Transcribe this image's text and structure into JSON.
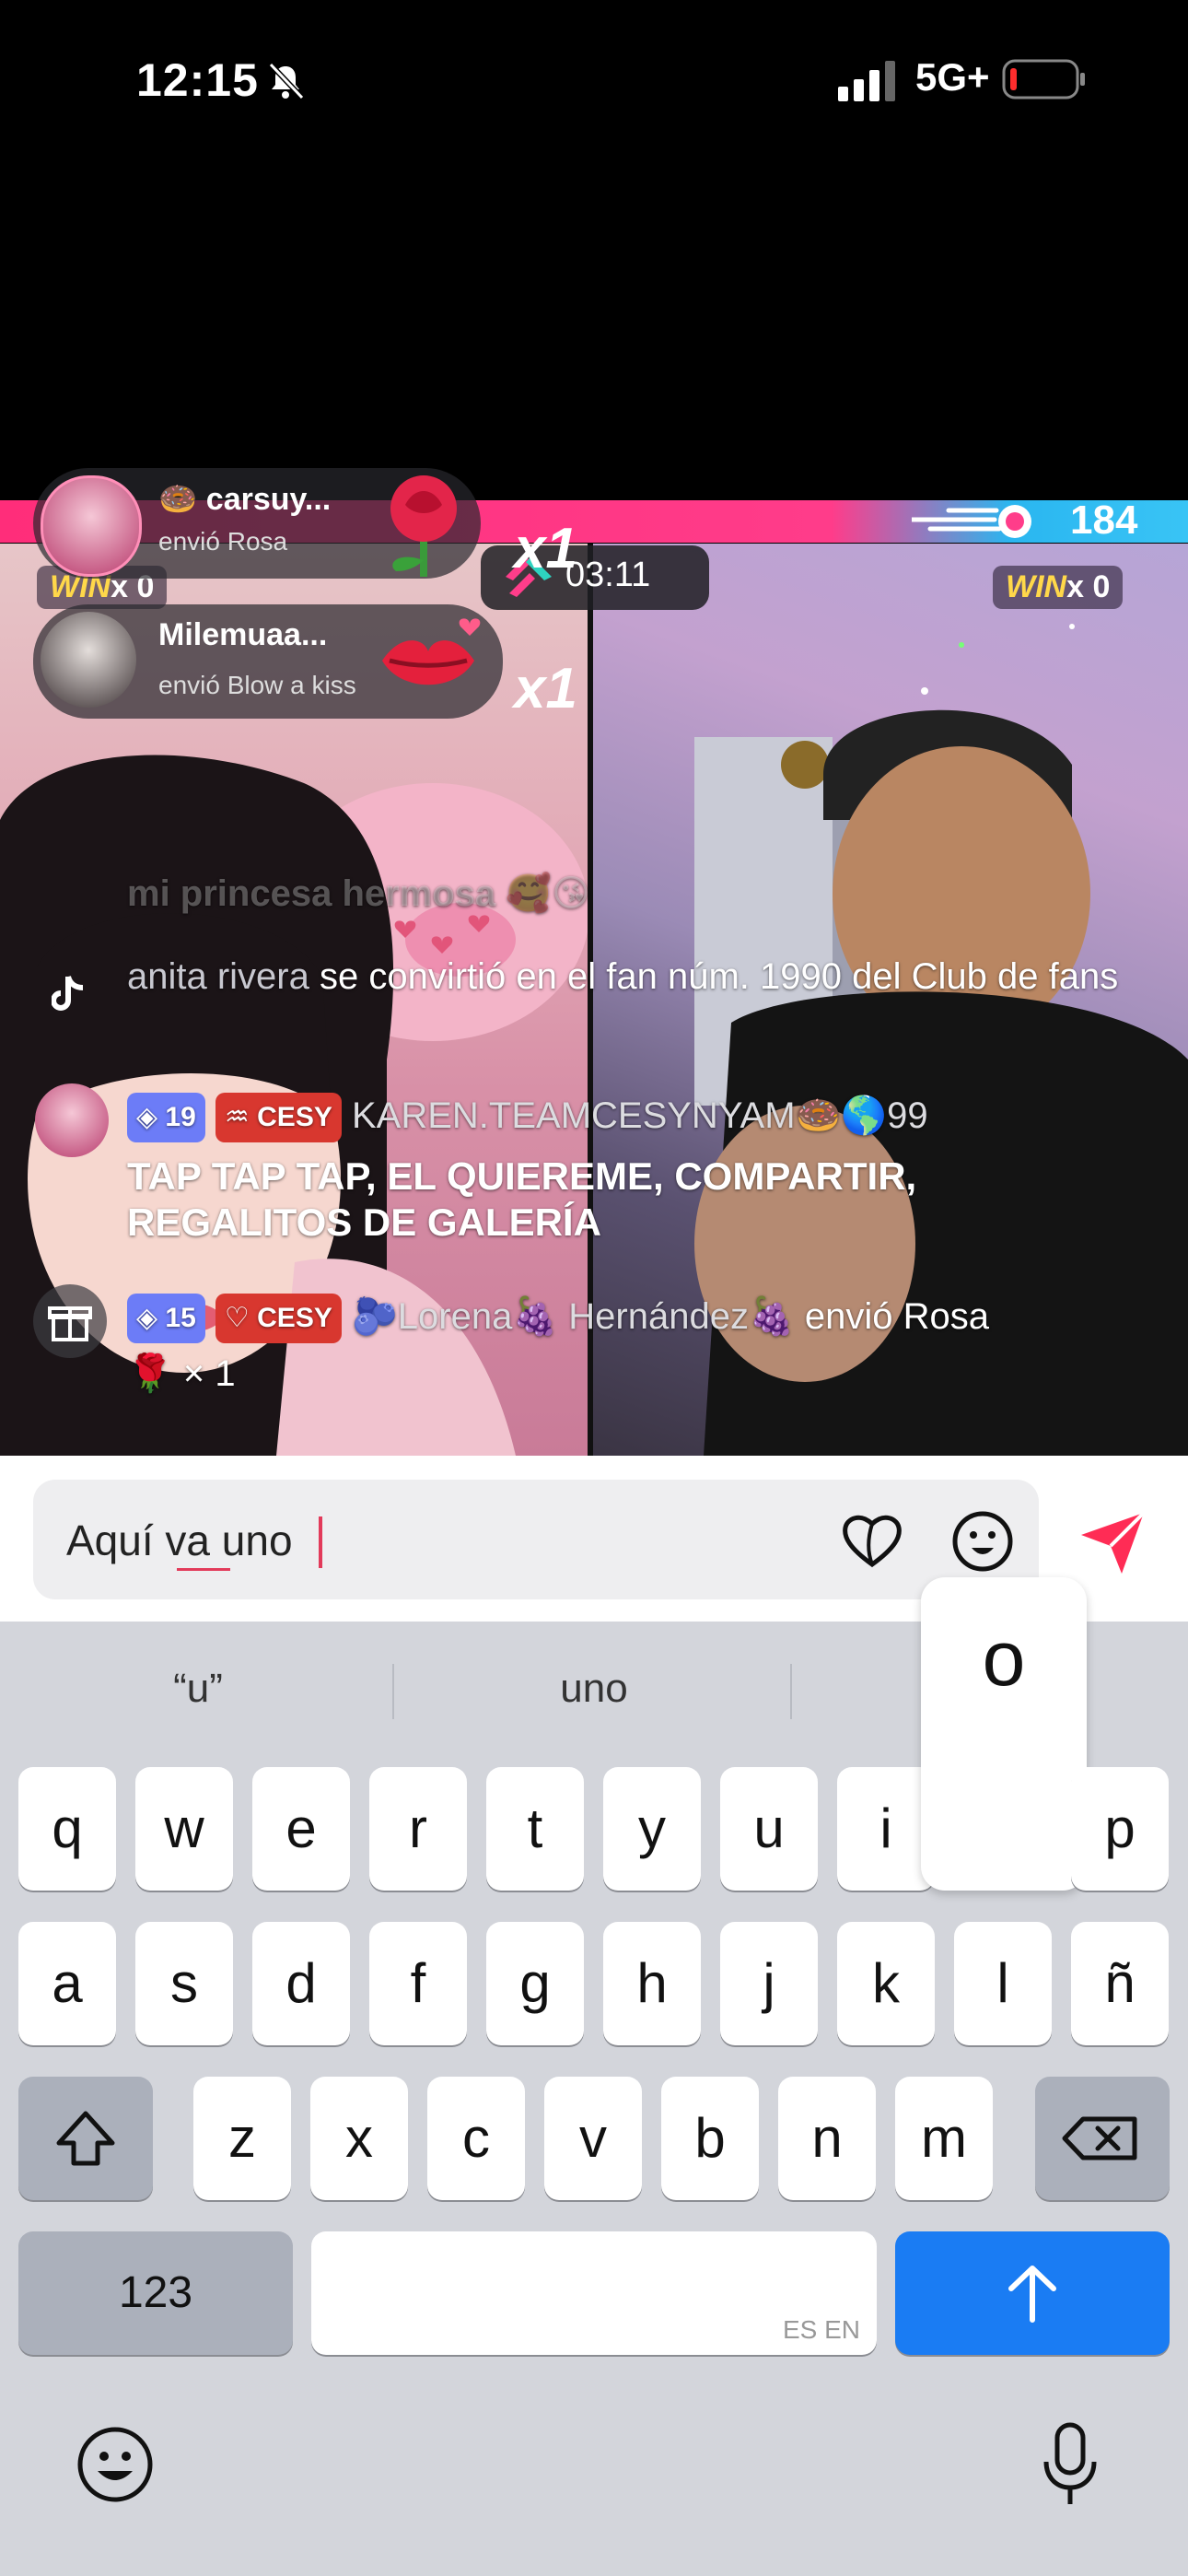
{
  "status_bar": {
    "time": "12:15",
    "network": "5G+"
  },
  "live": {
    "pk_score_right": "184",
    "timer": "03:11",
    "left_win": {
      "label": "WIN",
      "count": "x 0"
    },
    "right_win": {
      "label": "WIN",
      "count": "x 0"
    },
    "gifts": [
      {
        "name": "carsuy...",
        "action": "envió Rosa",
        "multiplier": "x1"
      },
      {
        "name": "Milemuaa...",
        "action": "envió Blow a kiss",
        "multiplier": "x1"
      }
    ],
    "chat": {
      "faded": "mi princesa hermosa",
      "fan_user": "anita rivera",
      "fan_text": " se convirtió en el fan núm. 1990 del Club de fans",
      "msg_level": "19",
      "msg_club": "CESY",
      "msg_user": "KAREN.TEAMCESYNYAM",
      "msg_user_suffix": "99",
      "msg_text": "TAP TAP TAP, EL QUIEREME, COMPARTIR, REGALITOS DE GALERÍA",
      "gift_level": "15",
      "gift_club": "CESY",
      "gift_user": "Lorena",
      "gift_user2": "Hernández",
      "gift_text": " envió Rosa",
      "gift_count": "× 1"
    }
  },
  "input": {
    "value": "Aquí va uno"
  },
  "keyboard": {
    "suggestions": [
      "“u”",
      "uno",
      "o"
    ],
    "popup_key": "o",
    "row1": [
      "q",
      "w",
      "e",
      "r",
      "t",
      "y",
      "u",
      "i",
      "o",
      "p"
    ],
    "row2": [
      "a",
      "s",
      "d",
      "f",
      "g",
      "h",
      "j",
      "k",
      "l",
      "ñ"
    ],
    "row3": [
      "z",
      "x",
      "c",
      "v",
      "b",
      "n",
      "m"
    ],
    "numbers_key": "123",
    "space_lang": "ES EN"
  }
}
